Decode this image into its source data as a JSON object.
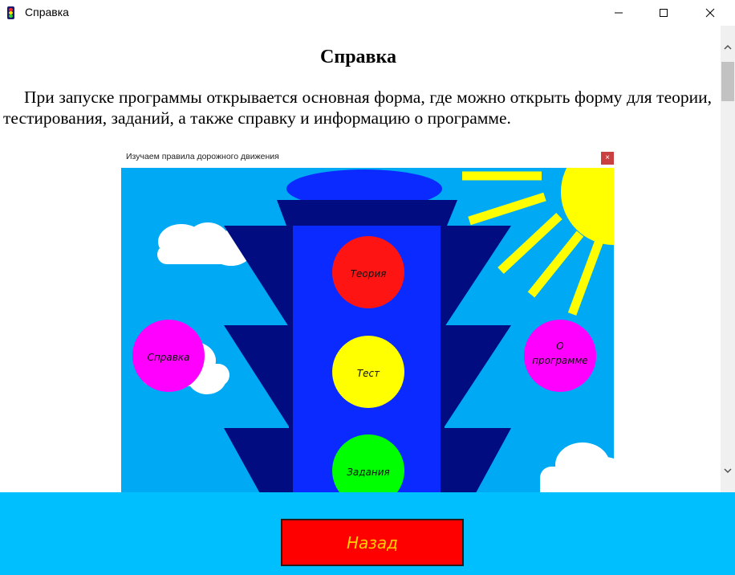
{
  "window": {
    "title": "Справка",
    "icon": "traffic-light-icon"
  },
  "controls": {
    "minimize": "minimize-icon",
    "maximize": "maximize-icon",
    "close": "close-icon"
  },
  "help": {
    "heading": "Справка",
    "paragraph": "При запуске программы открывается основная форма, где можно открыть форму для теории, тестирования, заданий, а также справку и информацию о программе."
  },
  "screenshot": {
    "title": "Изучаем правила дорожного движения",
    "close_glyph": "×",
    "lights": {
      "top": "Теория",
      "middle": "Тест",
      "bottom": "Задания"
    },
    "left_circle": "Справка",
    "right_circle_line1": "О",
    "right_circle_line2": "программе"
  },
  "footer": {
    "back_label": "Назад"
  },
  "colors": {
    "sky": "#00a9f4",
    "bottom_bar": "#00bfff",
    "back_button": "#ff0000",
    "back_text": "#ffd200",
    "traffic_light_body": "#0a2aff",
    "traffic_light_dark": "#000c80",
    "light_red": "#ff1414",
    "light_yellow": "#ffff00",
    "light_green": "#00ff00",
    "side_circles": "#ff00ff",
    "sun": "#ffff00"
  }
}
